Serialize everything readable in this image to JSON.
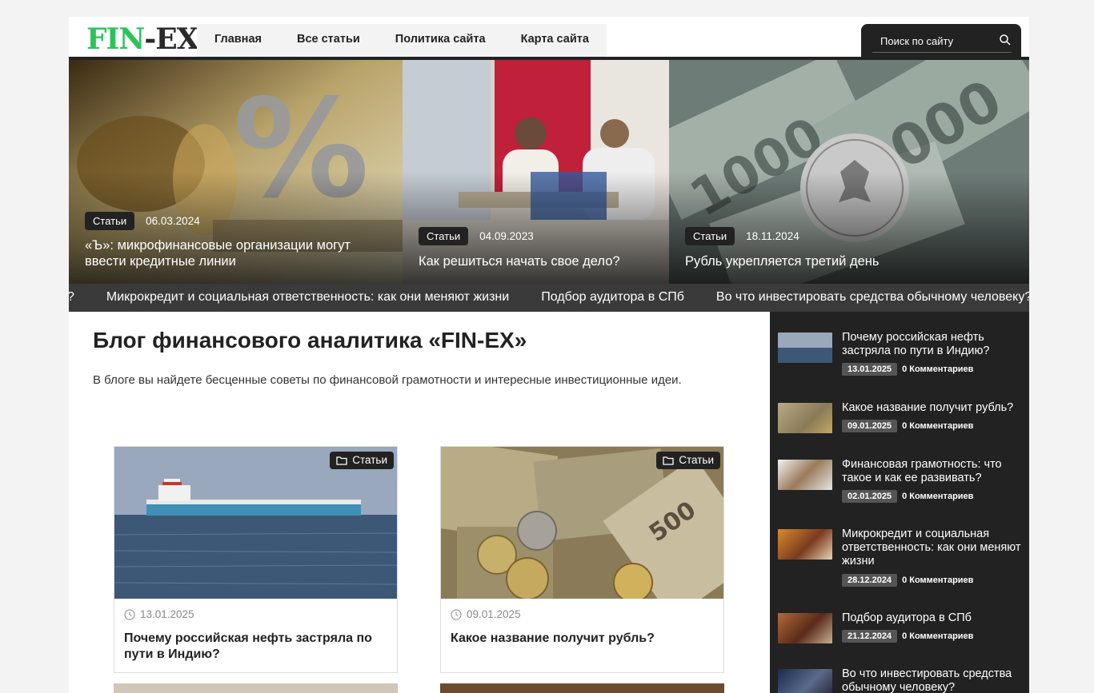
{
  "header": {
    "logo": {
      "fin": "FIN",
      "dash": "-",
      "ex": "EX"
    },
    "nav": [
      "Главная",
      "Все статьи",
      "Политика сайта",
      "Карта сайта"
    ],
    "search_placeholder": "Поиск по сайту"
  },
  "hero": [
    {
      "category": "Статьи",
      "date": "06.03.2024",
      "title": "«Ъ»: микрофинансовые организации могут ввести кредитные линии"
    },
    {
      "category": "Статьи",
      "date": "04.09.2023",
      "title": "Как решиться начать свое дело?"
    },
    {
      "category": "Статьи",
      "date": "18.11.2024",
      "title": "Рубль укрепляется третий день"
    }
  ],
  "ticker": [
    "?",
    "Микрокредит и социальная ответственность: как они меняют жизни",
    "Подбор аудитора в СПб",
    "Во что инвестировать средства обычному человеку?"
  ],
  "main": {
    "title": "Блог финансового аналитика «FIN-EX»",
    "description": "В блоге вы найдете бесценные советы по финансовой грамотности и интересные инвестиционные идеи.",
    "posts": [
      {
        "category": "Статьи",
        "date": "13.01.2025",
        "title": "Почему российская нефть застряла по пути в Индию?"
      },
      {
        "category": "Статьи",
        "date": "09.01.2025",
        "title": "Какое название получит рубль?"
      }
    ]
  },
  "sidebar": [
    {
      "title": "Почему российская нефть застряла по пути в Индию?",
      "date": "13.01.2025",
      "comments": "0 Комментариев"
    },
    {
      "title": "Какое название получит рубль?",
      "date": "09.01.2025",
      "comments": "0 Комментариев"
    },
    {
      "title": "Финансовая грамотность: что такое и как ее развивать?",
      "date": "02.01.2025",
      "comments": "0 Комментариев"
    },
    {
      "title": "Микрокредит и социальная ответственность: как они меняют жизни",
      "date": "28.12.2024",
      "comments": "0 Комментариев"
    },
    {
      "title": "Подбор аудитора в СПб",
      "date": "21.12.2024",
      "comments": "0 Комментариев"
    },
    {
      "title": "Во что инвестировать средства обычному человеку?",
      "date": "",
      "comments": ""
    }
  ],
  "colors": {
    "brand_green": "#2cc35b",
    "dark": "#222222",
    "ticker_bg": "#3a3a3a"
  },
  "icons": {
    "search": "search-icon",
    "folder": "folder-icon",
    "clock": "clock-icon"
  }
}
